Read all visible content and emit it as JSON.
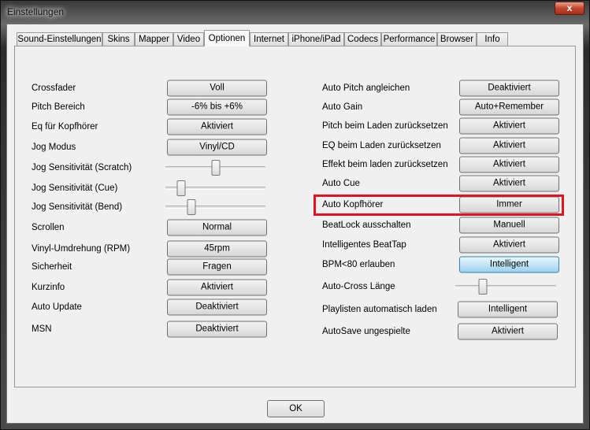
{
  "window": {
    "title": "Einstellungen",
    "close": "x"
  },
  "tabs": [
    "Sound-Einstellungen",
    "Skins",
    "Mapper",
    "Video",
    "Optionen",
    "Internet",
    "iPhone/iPad",
    "Codecs",
    "Performance",
    "Browser",
    "Info"
  ],
  "active_tab": "Optionen",
  "left": [
    {
      "label": "Crossfader",
      "value": "Voll"
    },
    {
      "label": "Pitch Bereich",
      "value": "-6% bis +6%"
    },
    {
      "label": "Eq für Kopfhörer",
      "value": "Aktiviert"
    },
    {
      "label": "Jog Modus",
      "value": "Vinyl/CD"
    },
    {
      "label": "Jog Sensitivität (Scratch)",
      "slider": 0.5
    },
    {
      "label": "Jog Sensitivität (Cue)",
      "slider": 0.16
    },
    {
      "label": "Jog Sensitivität (Bend)",
      "slider": 0.26
    },
    {
      "label": "Scrollen",
      "value": "Normal"
    },
    {
      "label": "Vinyl-Umdrehung (RPM)",
      "value": "45rpm"
    },
    {
      "label": "Sicherheit",
      "value": "Fragen"
    },
    {
      "label": "Kurzinfo",
      "value": "Aktiviert"
    },
    {
      "label": "Auto Update",
      "value": "Deaktiviert"
    },
    {
      "label": "MSN",
      "value": "Deaktiviert"
    }
  ],
  "right": [
    {
      "label": "Auto Pitch angleichen",
      "value": "Deaktiviert"
    },
    {
      "label": "Auto Gain",
      "value": "Auto+Remember"
    },
    {
      "label": "Pitch beim Laden zurücksetzen",
      "value": "Aktiviert"
    },
    {
      "label": "EQ beim Laden zurücksetzen",
      "value": "Aktiviert"
    },
    {
      "label": "Effekt beim laden zurücksetzen",
      "value": "Aktiviert"
    },
    {
      "label": "Auto Cue",
      "value": "Aktiviert"
    },
    {
      "label": "Auto Kopfhörer",
      "value": "Immer"
    },
    {
      "label": "BeatLock ausschalten",
      "value": "Manuell"
    },
    {
      "label": "Intelligentes BeatTap",
      "value": "Aktiviert"
    },
    {
      "label": "BPM<80 erlauben",
      "value": "Intelligent"
    },
    {
      "label": "Auto-Cross Länge",
      "slider": 0.27
    },
    {
      "label": "Playlisten automatisch laden",
      "value": "Intelligent"
    },
    {
      "label": "AutoSave ungespielte",
      "value": "Aktiviert"
    }
  ],
  "ok": "OK"
}
